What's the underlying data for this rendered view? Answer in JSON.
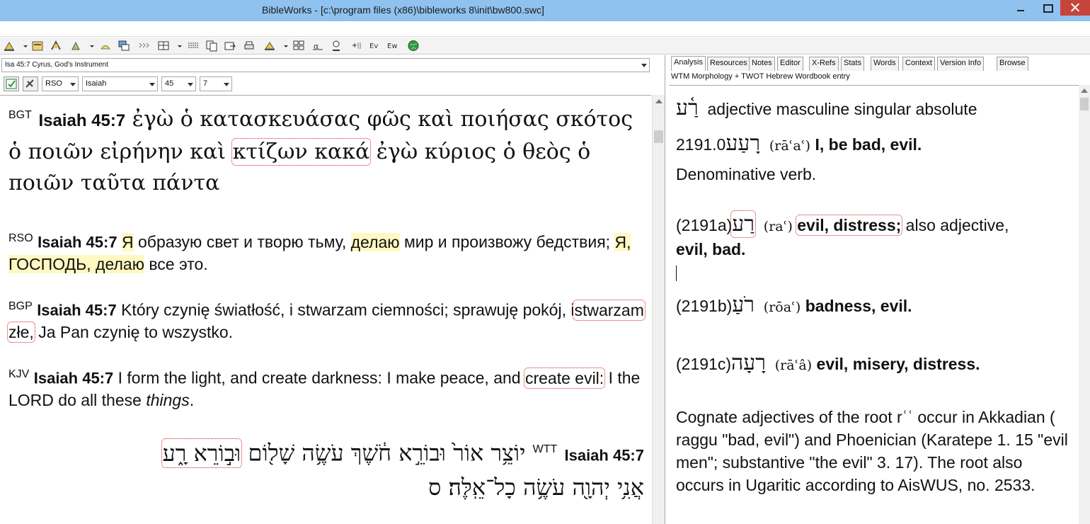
{
  "window": {
    "title": "BibleWorks - [c:\\program files (x86)\\bibleworks 8\\init\\bw800.swc]"
  },
  "toolbar": {
    "icons": [
      "search-icon",
      "browse-icon",
      "tools-icon",
      "word-icon",
      "lexicon-icon",
      "windows-icon",
      "arrows-icon",
      "grid-icon",
      "list-icon",
      "copy-icon",
      "export-icon",
      "print-icon",
      "stats-icon",
      "layout-icon",
      "analysis-icon",
      "editor-icon",
      "add-icon",
      "version-icon",
      "word-list-icon",
      "globe-icon"
    ]
  },
  "left": {
    "passage": "Isa 45:7 Cyrus, God's Instrument",
    "version_select": "RSO",
    "book_select": "Isaiah",
    "chapter_select": "45",
    "verse_select": "7",
    "verses": {
      "bgt": {
        "version": "BGT",
        "ref": "Isaiah 45:7",
        "text_a": "ἐγὼ ὁ κατασκευάσας φῶς καὶ ποιήσας σκότος ὁ ποιῶν εἰρήνην καὶ",
        "text_hl": "κτίζων κακά",
        "text_b": "ἐγὼ κύριος ὁ θεὸς ὁ ποιῶν ταῦτα πάντα"
      },
      "rso": {
        "version": "RSO",
        "ref": "Isaiah 45:7",
        "p1": "Я",
        "p2": "образую свет и творю тьму,",
        "p3": "делаю",
        "p4": "мир и произвожу бедствия;",
        "p5": "Я, ГОСПОДЬ, делаю",
        "p6": "все это."
      },
      "bgp": {
        "version": "BGP",
        "ref": "Isaiah 45:7",
        "p1": "Który czynię światłość, i stwarzam ciemności; sprawuję pokój, i",
        "p2": "stwarzam złe,",
        "p3": "Ja Pan czynię to wszystko."
      },
      "kjv": {
        "version": "KJV",
        "ref": "Isaiah 45:7",
        "p1": "I form the light, and create darkness: I make peace, and",
        "p2": "create evil:",
        "p3": "I the LORD do all these",
        "p4": "things",
        "p5": "."
      },
      "wtt": {
        "version": "WTT",
        "ref": "Isaiah 45:7",
        "line1": "יוֹצֵ֥ר אוֹר֙ וּבוֹרֵ֣א חֹ֔שֶׁךְ עֹשֶׂ֥ה שָׁל֖וֹם",
        "line1_hl": "וּב֣וֹרֵא רָ֑ע",
        "line2": "אֲנִ֥י יְהוָ֖ה עֹשֶׂ֥ה כָל־אֵֽלֶּה׃ ס"
      }
    }
  },
  "right": {
    "tabs": [
      "Analysis",
      "Resources",
      "Notes",
      "Editor",
      "X-Refs",
      "Stats",
      "Words",
      "Context",
      "Version Info",
      "Browse"
    ],
    "active_tab": "Analysis",
    "subtitle": "WTM Morphology + TWOT Hebrew Wordbook entry",
    "morph_word": "רַ֫ע",
    "morph_desc": "adjective masculine singular absolute",
    "e1_num": "2191.0",
    "e1_hw": "רָעַע",
    "e1_tr": "(rāʿaʿ)",
    "e1_gloss": "I, be bad, evil.",
    "e1_note": "Denominative verb.",
    "e2_num": "(2191a)",
    "e2_hw": "רַע",
    "e2_tr": "(raʿ)",
    "e2_gloss": "evil, distress;",
    "e2_rest": "also adjective,",
    "e2_gloss2": "evil, bad.",
    "e3_num": "(2191b)",
    "e3_hw": "רֹעַ",
    "e3_tr": "(rōaʿ)",
    "e3_gloss": "badness, evil.",
    "e4_num": "(2191c)",
    "e4_hw": "רָעָה",
    "e4_tr": "(rāʿâ)",
    "e4_gloss": "evil, misery, distress.",
    "para_a": "Cognate adjectives of the root",
    "para_root": "rʿʿ",
    "para_b": "occur in Akkadian (",
    "para_akk": "raggu",
    "para_c": "\"bad, evil\") and Phoenician (Karatepe 1. 15 \"evil men\"; substantive \"the evil\" 3. 17). The root also occurs in Ugaritic according to AisWUS, no. 2533."
  }
}
